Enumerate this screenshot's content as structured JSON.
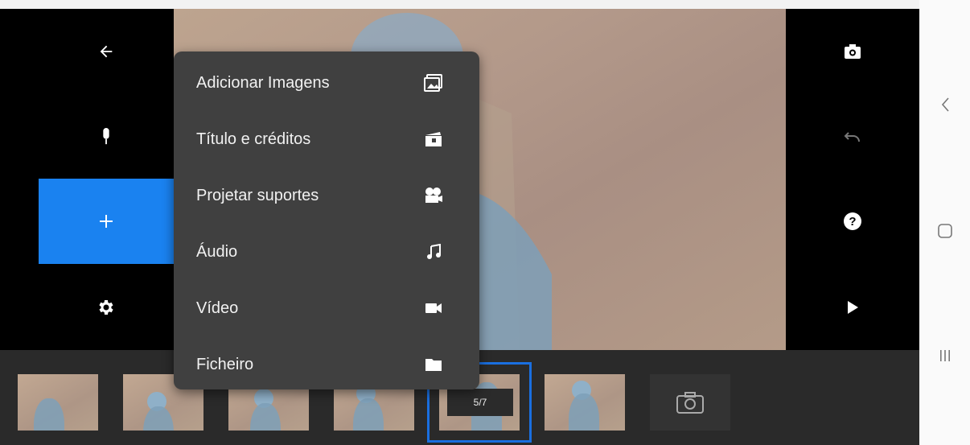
{
  "left_rail": {
    "items": [
      {
        "icon": "back-arrow-icon"
      },
      {
        "icon": "microphone-icon"
      },
      {
        "icon": "plus-icon",
        "active": true
      },
      {
        "icon": "gear-icon"
      }
    ],
    "accent": "#1a82f0"
  },
  "menu": {
    "items": [
      {
        "label": "Adicionar Imagens",
        "icon": "images-icon"
      },
      {
        "label": "Título e créditos",
        "icon": "clapperboard-icon"
      },
      {
        "label": "Projetar suportes",
        "icon": "film-camera-icon"
      },
      {
        "label": "Áudio",
        "icon": "music-note-icon"
      },
      {
        "label": "Vídeo",
        "icon": "video-camera-icon"
      },
      {
        "label": "Ficheiro",
        "icon": "folder-icon"
      }
    ]
  },
  "right_rail": {
    "items": [
      {
        "icon": "camera-icon"
      },
      {
        "icon": "undo-icon"
      },
      {
        "icon": "help-icon"
      },
      {
        "icon": "play-icon"
      }
    ]
  },
  "timeline": {
    "frame_counter": "5/7",
    "selected_index": 4,
    "thumbnail_count": 6,
    "add_frame_icon": "camera-icon"
  },
  "system_nav": {
    "items": [
      {
        "icon": "back-chevron-icon"
      },
      {
        "icon": "home-icon"
      },
      {
        "icon": "recents-icon"
      }
    ]
  }
}
